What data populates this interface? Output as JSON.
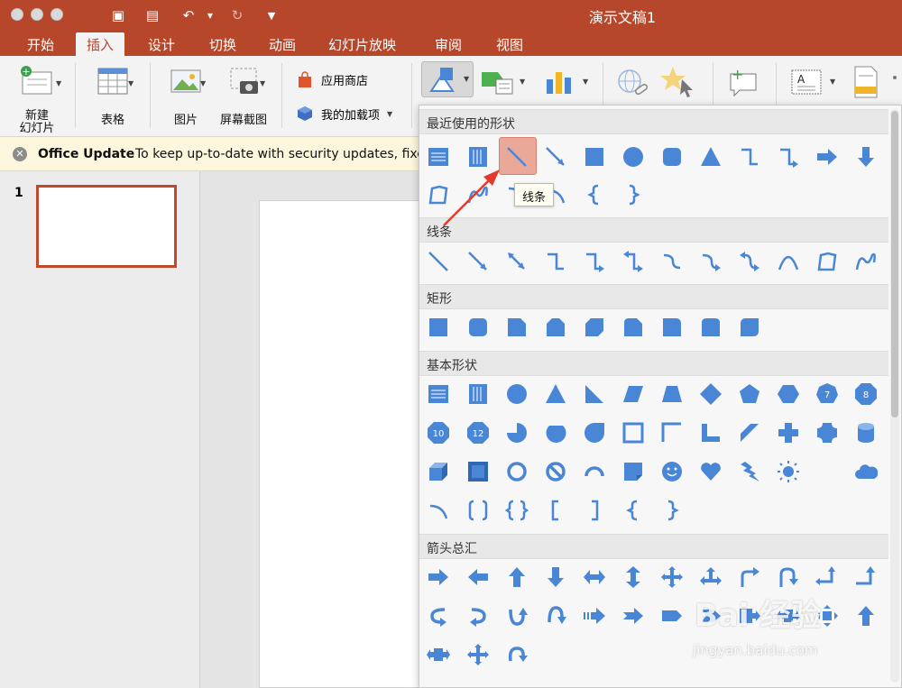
{
  "window": {
    "title": "演示文稿1"
  },
  "tabs": [
    {
      "label": "开始"
    },
    {
      "label": "插入"
    },
    {
      "label": "设计"
    },
    {
      "label": "切换"
    },
    {
      "label": "动画"
    },
    {
      "label": "幻灯片放映"
    },
    {
      "label": "审阅"
    },
    {
      "label": "视图"
    }
  ],
  "ribbon": {
    "new_slide_line1": "新建",
    "new_slide_line2": "幻灯片",
    "table": "表格",
    "picture": "图片",
    "screenshot": "屏幕截图",
    "app_store": "应用商店",
    "my_addins": "我的加载项"
  },
  "notice": {
    "title": "Office Update",
    "text": "To keep up-to-date with security updates, fixes"
  },
  "thumbnails": {
    "slide_number": "1"
  },
  "shapes_menu": {
    "sections": [
      {
        "label": "最近使用的形状"
      },
      {
        "label": "线条"
      },
      {
        "label": "矩形"
      },
      {
        "label": "基本形状"
      },
      {
        "label": "箭头总汇"
      }
    ],
    "tooltip": "线条",
    "octagon_labels": [
      "7",
      "8",
      "10",
      "12"
    ]
  },
  "colors": {
    "accent": "#b7472a",
    "shape_blue": "#4a86d6"
  },
  "watermark": {
    "logo": "Bai 经验",
    "url": "jingyan.baidu.com"
  }
}
